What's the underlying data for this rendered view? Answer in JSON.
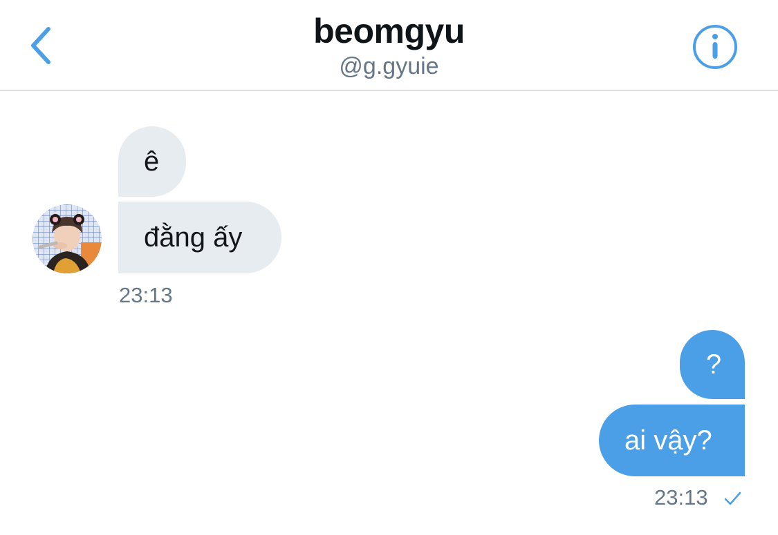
{
  "header": {
    "back_icon": "chevron-left-icon",
    "title": "beomgyu",
    "handle": "@g.gyuie",
    "info_icon": "info-icon",
    "accent_color": "#4b9fe6"
  },
  "conversation": {
    "incoming": {
      "avatar": "profile-photo",
      "messages": [
        "ê",
        "đằng ấy"
      ],
      "time": "23:13"
    },
    "outgoing": {
      "messages": [
        "?",
        "ai vậy?"
      ],
      "time": "23:13",
      "status_icon": "read-check-icon"
    }
  },
  "colors": {
    "incoming_bubble": "#e6ecf0",
    "outgoing_bubble": "#4b9fe6",
    "secondary_text": "#657786"
  }
}
